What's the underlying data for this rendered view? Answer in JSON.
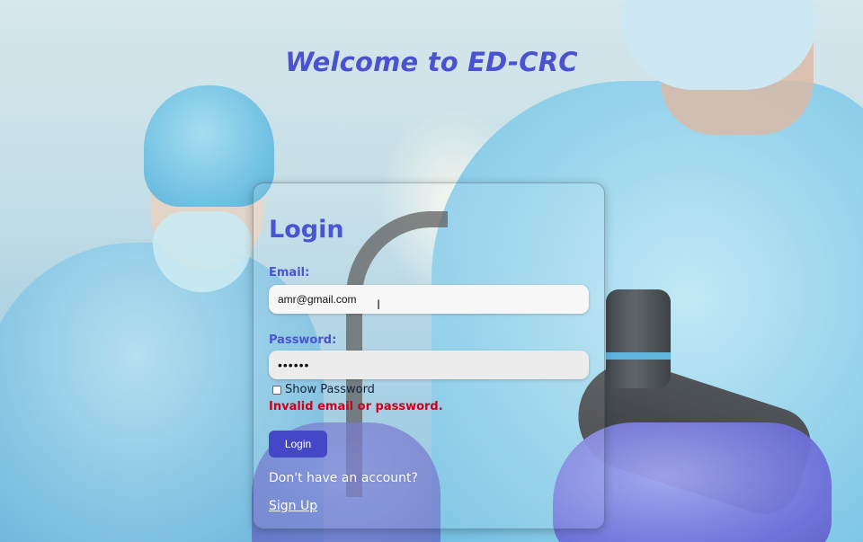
{
  "header": {
    "title": "Welcome to ED-CRC"
  },
  "login_form": {
    "title": "Login",
    "email": {
      "label": "Email:",
      "value": "amr@gmail.com",
      "placeholder": ""
    },
    "password": {
      "label": "Password:",
      "value": "••••••"
    },
    "show_password": {
      "label": "Show Password",
      "checked": false
    },
    "error_message": "Invalid email or password.",
    "login_button_label": "Login",
    "signup_prompt": "Don't have an account?",
    "signup_link_label": "Sign Up"
  },
  "colors": {
    "accent": "#4a55d4",
    "button": "#4448c6",
    "error": "#d0001b"
  },
  "icons": {
    "cursor": "text-cursor-icon"
  }
}
